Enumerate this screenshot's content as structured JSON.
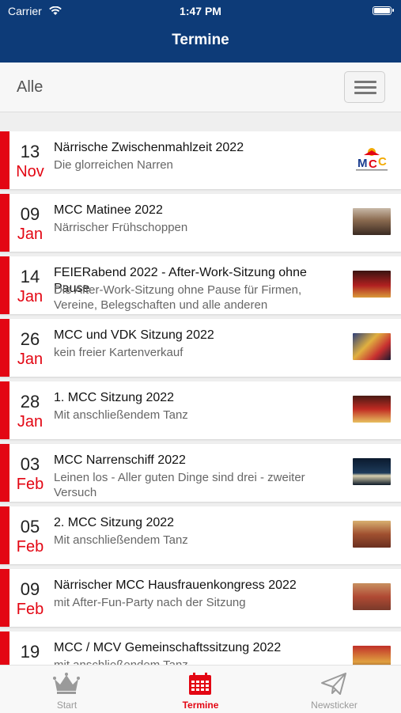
{
  "status_bar": {
    "carrier": "Carrier",
    "time": "1:47 PM"
  },
  "header": {
    "title": "Termine"
  },
  "filter": {
    "label": "Alle"
  },
  "events": [
    {
      "day": "13",
      "month": "Nov",
      "title": "Närrische Zwischenmahlzeit 2022",
      "subtitle": "Die glorreichen Narren"
    },
    {
      "day": "09",
      "month": "Jan",
      "title": "MCC Matinee 2022",
      "subtitle": "Närrischer Frühschoppen"
    },
    {
      "day": "14",
      "month": "Jan",
      "title": "FEIERabend 2022 - After-Work-Sitzung ohne Pause",
      "subtitle": "Die After-Work-Sitzung ohne Pause für Firmen, Vereine, Belegschaften und alle anderen"
    },
    {
      "day": "26",
      "month": "Jan",
      "title": "MCC und VDK Sitzung 2022",
      "subtitle": "kein freier Kartenverkauf"
    },
    {
      "day": "28",
      "month": "Jan",
      "title": "1. MCC Sitzung 2022",
      "subtitle": "Mit anschließendem Tanz"
    },
    {
      "day": "03",
      "month": "Feb",
      "title": "MCC Narrenschiff 2022",
      "subtitle": "Leinen los - Aller guten Dinge sind drei - zweiter Versuch"
    },
    {
      "day": "05",
      "month": "Feb",
      "title": "2. MCC Sitzung 2022",
      "subtitle": "Mit anschließendem Tanz"
    },
    {
      "day": "09",
      "month": "Feb",
      "title": "Närrischer MCC Hausfrauenkongress 2022",
      "subtitle": "mit After-Fun-Party nach der Sitzung"
    },
    {
      "day": "19",
      "month": "",
      "title": "MCC / MCV Gemeinschaftssitzung 2022",
      "subtitle": "mit anschließendem Tanz"
    }
  ],
  "tabs": [
    {
      "label": "Start",
      "icon": "crown-icon"
    },
    {
      "label": "Termine",
      "icon": "calendar-icon"
    },
    {
      "label": "Newsticker",
      "icon": "paper-plane-icon"
    }
  ],
  "colors": {
    "header": "#0d3b78",
    "accent": "#e30613"
  }
}
